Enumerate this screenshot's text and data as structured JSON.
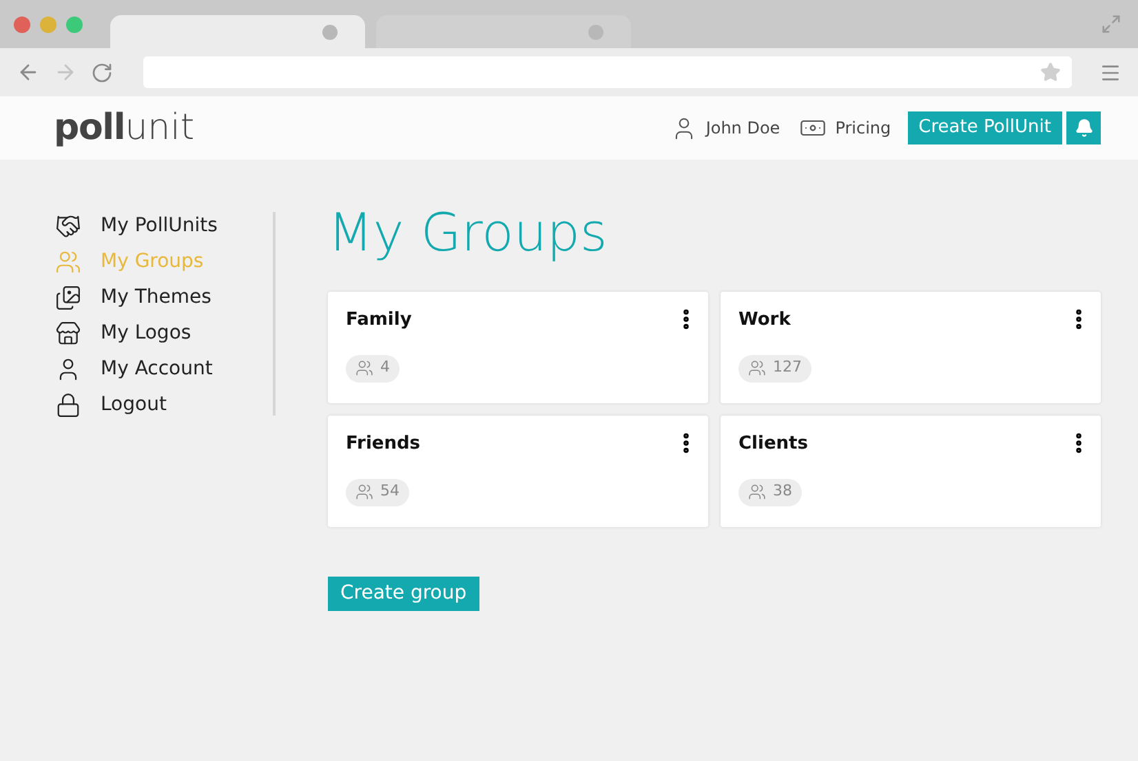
{
  "browser": {
    "tabs": [
      {
        "selected": true
      },
      {
        "selected": false
      }
    ]
  },
  "header": {
    "logo": {
      "bold": "poll",
      "light": "unit"
    },
    "user": "John Doe",
    "pricing": "Pricing",
    "create_button": "Create PollUnit"
  },
  "sidebar": {
    "items": [
      {
        "label": "My PollUnits",
        "selected": false
      },
      {
        "label": "My Groups",
        "selected": true
      },
      {
        "label": "My Themes",
        "selected": false
      },
      {
        "label": "My Logos",
        "selected": false
      },
      {
        "label": "My Account",
        "selected": false
      },
      {
        "label": "Logout",
        "selected": false
      }
    ]
  },
  "page_title": "My Groups",
  "groups": [
    {
      "name": "Family",
      "members": "4"
    },
    {
      "name": "Work",
      "members": "127"
    },
    {
      "name": "Friends",
      "members": "54"
    },
    {
      "name": "Clients",
      "members": "38"
    }
  ],
  "create_group_button": "Create group"
}
